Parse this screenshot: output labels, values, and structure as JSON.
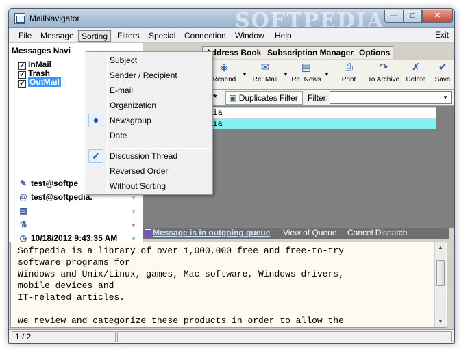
{
  "window": {
    "title": "MailNavigator",
    "watermark": "SOFTPEDIA"
  },
  "menubar": {
    "items": [
      "File",
      "Message",
      "Sorting",
      "Filters",
      "Special",
      "Connection",
      "Window",
      "Help"
    ],
    "active": "Sorting",
    "exit": "Exit"
  },
  "sorting_menu": {
    "items": [
      "Subject",
      "Sender / Recipient",
      "E-mail",
      "Organization",
      "Newsgroup",
      "Date"
    ],
    "items2": [
      "Discussion Thread",
      "Reversed Order",
      "Without Sorting"
    ],
    "selected_radio": "Newsgroup",
    "checked": "Discussion Thread"
  },
  "navigator": {
    "header": "Messages Navi",
    "folders": [
      {
        "label": "InMail",
        "checked": true,
        "selected": false
      },
      {
        "label": "Trash",
        "checked": true,
        "selected": false
      },
      {
        "label": "OutMail",
        "checked": true,
        "selected": true
      }
    ],
    "info": {
      "to": "test@softpe",
      "from": "test@softpedia.",
      "date": "10/18/2012 9:43:35 AM"
    }
  },
  "tabs": [
    "Address Book",
    "Subscription Manager",
    "Options"
  ],
  "toolbar": {
    "resend": "Resend",
    "re_mail": "Re: Mail",
    "re_news": "Re: News",
    "print": "Print",
    "to_archive": "To Archive",
    "delete": "Delete",
    "save": "Save"
  },
  "filterbar": {
    "duplicates": "Duplicates Filter",
    "filter_label": "Filter:",
    "filter_value": ""
  },
  "messages": [
    {
      "text": "edia",
      "highlighted": false
    },
    {
      "text": "edia",
      "highlighted": true
    }
  ],
  "queue": {
    "status": "Message is in outgoing queue",
    "view": "View of Queue",
    "cancel": "Cancel Dispatch"
  },
  "preview": {
    "lines": [
      "Softpedia is a library of over 1,000,000 free and free-to-try",
      "software programs for",
      "Windows and Unix/Linux, games, Mac software, Windows drivers,",
      "mobile devices and",
      "IT-related articles.",
      "",
      "We review and categorize these products in order to allow the"
    ]
  },
  "status": {
    "pager": "1 / 2"
  }
}
